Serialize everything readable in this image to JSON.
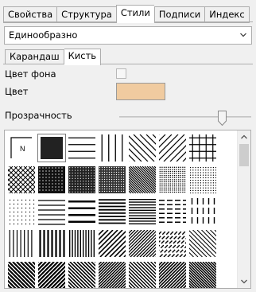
{
  "tabs": [
    {
      "label": "Свойства",
      "active": false
    },
    {
      "label": "Структура",
      "active": false
    },
    {
      "label": "Стили",
      "active": true
    },
    {
      "label": "Подписи",
      "active": false
    },
    {
      "label": "Индекс",
      "active": false
    }
  ],
  "style_select": {
    "value": "Единообразно"
  },
  "subtabs": [
    {
      "label": "Карандаш",
      "active": false
    },
    {
      "label": "Кисть",
      "active": true
    }
  ],
  "bg_color": {
    "label": "Цвет фона",
    "checked": false
  },
  "color": {
    "label": "Цвет",
    "value": "#f0cba0"
  },
  "transparency": {
    "label": "Прозрачность",
    "level_percent": 80
  },
  "patterns": {
    "selected_index": 1,
    "items": [
      {
        "icon": "N-frame-pattern-icon",
        "label": "N"
      },
      {
        "icon": "solid-fill-pattern-icon"
      },
      {
        "icon": "horizontal-lines-pattern-icon"
      },
      {
        "icon": "vertical-lines-pattern-icon"
      },
      {
        "icon": "diagonal-lines-pattern-icon"
      },
      {
        "icon": "reverse-diagonal-lines-pattern-icon"
      },
      {
        "icon": "grid-pattern-icon"
      },
      {
        "icon": "diagonal-cross-pattern-icon"
      },
      {
        "icon": "dense-dots-90-pattern-icon"
      },
      {
        "icon": "dense-dots-75-pattern-icon"
      },
      {
        "icon": "dense-dots-60-pattern-icon"
      },
      {
        "icon": "dense-dots-50-pattern-icon"
      },
      {
        "icon": "dense-dots-40-pattern-icon"
      },
      {
        "icon": "dots-25-pattern-icon"
      },
      {
        "icon": "dots-10-pattern-icon"
      },
      {
        "icon": "thin-horizontal-pattern-icon"
      },
      {
        "icon": "thick-horizontal-pattern-icon"
      },
      {
        "icon": "dense-horizontal-pattern-icon"
      },
      {
        "icon": "narrow-horizontal-pattern-icon"
      },
      {
        "icon": "dashed-horizontal-pattern-icon"
      },
      {
        "icon": "dashed-vertical-pattern-icon"
      },
      {
        "icon": "thin-vertical-pattern-icon"
      },
      {
        "icon": "thick-vertical-pattern-icon"
      },
      {
        "icon": "dense-vertical-pattern-icon"
      },
      {
        "icon": "wide-diagonal-pattern-icon"
      },
      {
        "icon": "narrow-diagonal-pattern-icon"
      },
      {
        "icon": "dashed-diagonal-pattern-icon"
      },
      {
        "icon": "light-diagonal-pattern-icon"
      },
      {
        "icon": "thick-diagonal-pattern-icon"
      },
      {
        "icon": "thick-reverse-diagonal-pattern-icon"
      },
      {
        "icon": "medium-diagonal-pattern-icon"
      },
      {
        "icon": "dense-diagonal-pattern-icon"
      },
      {
        "icon": "light-reverse-diagonal-pattern-icon"
      },
      {
        "icon": "medium-reverse-diagonal-pattern-icon"
      },
      {
        "icon": "dense-reverse-diagonal-pattern-icon"
      }
    ]
  },
  "scrollbar": {
    "up_icon": "scroll-up-arrow-icon",
    "down_icon": "scroll-down-arrow-icon"
  }
}
